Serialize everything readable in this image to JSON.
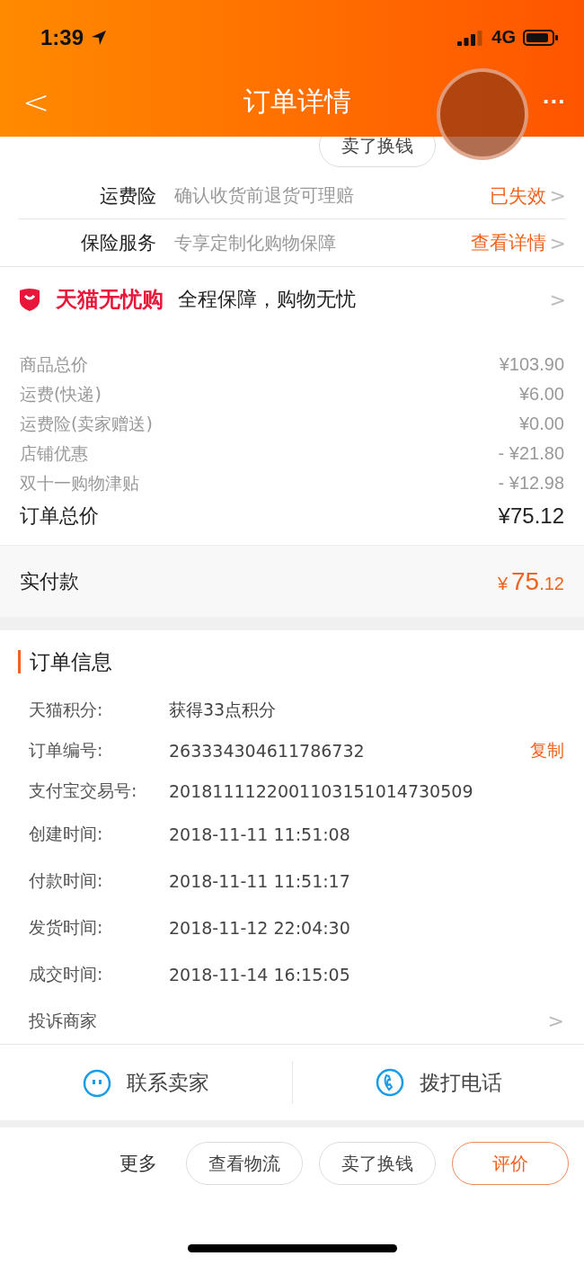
{
  "status_bar": {
    "time": "1:39",
    "network": "4G"
  },
  "nav": {
    "back": "<",
    "title": "订单详情",
    "more": "···"
  },
  "top_buttons": [
    "卖了换钱"
  ],
  "service_rows": [
    {
      "label": "运费险",
      "description": "确认收货前退货可理赔",
      "status": "已失效",
      "chevron": ">"
    },
    {
      "label": "保险服务",
      "description": "专享定制化购物保障",
      "status": "查看详情",
      "chevron": ">"
    }
  ],
  "guarantee": {
    "brand": "天猫无忧购",
    "text": "全程保障，购物无忧",
    "chevron": ">"
  },
  "price_lines": [
    {
      "label": "商品总价",
      "value": "¥103.90"
    },
    {
      "label": "运费(快递)",
      "value": "¥6.00"
    },
    {
      "label": "运费险(卖家赠送)",
      "value": "¥0.00"
    },
    {
      "label": "店铺优惠",
      "value": "- ¥21.80"
    },
    {
      "label": "双十一购物津贴",
      "value": "- ¥12.98"
    }
  ],
  "order_total": {
    "label": "订单总价",
    "value": "¥75.12"
  },
  "paid": {
    "label": "实付款",
    "currency": "¥",
    "integer": "75",
    "decimal": ".12"
  },
  "order_info": {
    "title": "订单信息",
    "rows": [
      {
        "label": "天猫积分:",
        "value": "获得33点积分"
      },
      {
        "label": "订单编号:",
        "value": "263334304611786732",
        "action": "复制"
      },
      {
        "label": "支付宝交易号:",
        "value": "2018111122001103151014730509"
      },
      {
        "label": "创建时间:",
        "value": "2018-11-11 11:51:08"
      },
      {
        "label": "付款时间:",
        "value": "2018-11-11 11:51:17"
      },
      {
        "label": "发货时间:",
        "value": "2018-11-12 22:04:30"
      },
      {
        "label": "成交时间:",
        "value": "2018-11-14 16:15:05"
      }
    ],
    "complaint": "投诉商家",
    "chevron": ">"
  },
  "contact": [
    {
      "kind": "chat",
      "label": "联系卖家"
    },
    {
      "kind": "phone",
      "label": "拨打电话"
    }
  ],
  "bottom_bar": {
    "more": "更多",
    "buttons": [
      {
        "label": "查看物流",
        "primary": false
      },
      {
        "label": "卖了换钱",
        "primary": false
      },
      {
        "label": "评价",
        "primary": true
      }
    ]
  }
}
